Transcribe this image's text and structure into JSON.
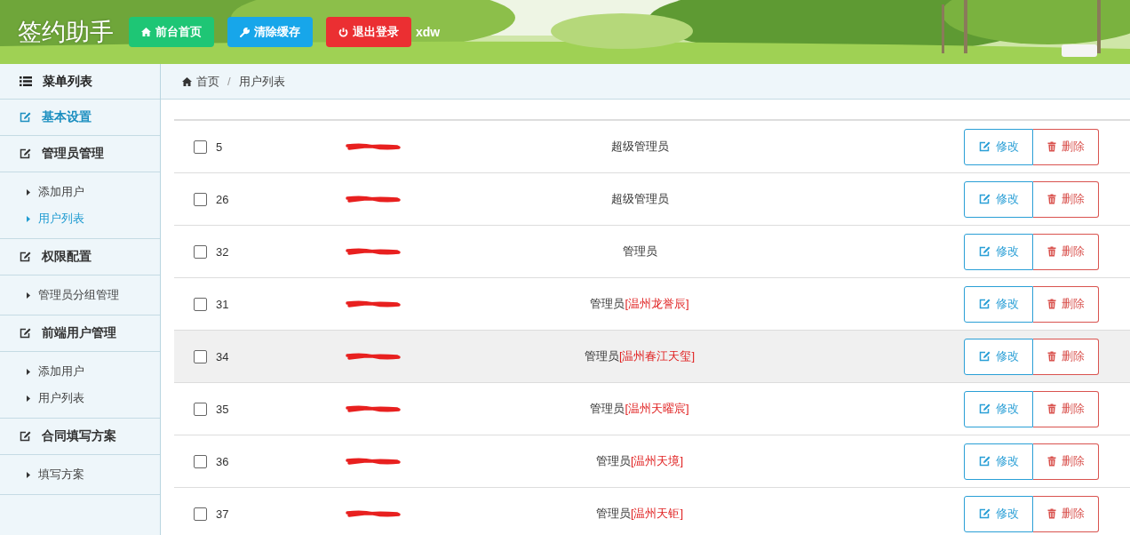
{
  "header": {
    "title": "签约助手",
    "buttons": [
      {
        "label": "前台首页",
        "kind": "home"
      },
      {
        "label": "清除缓存",
        "kind": "clear"
      },
      {
        "label": "退出登录",
        "kind": "logout"
      }
    ],
    "user": "xdw"
  },
  "sidebar": {
    "title": "菜单列表",
    "sections": [
      {
        "label": "基本设置",
        "selected": true
      },
      {
        "label": "管理员管理",
        "selected": false,
        "children": [
          {
            "label": "添加用户",
            "selected": false
          },
          {
            "label": "用户列表",
            "selected": true
          }
        ]
      },
      {
        "label": "权限配置",
        "selected": false,
        "children": [
          {
            "label": "管理员分组管理",
            "selected": false
          }
        ]
      },
      {
        "label": "前端用户管理",
        "selected": false,
        "children": [
          {
            "label": "添加用户",
            "selected": false
          },
          {
            "label": "用户列表",
            "selected": false
          }
        ]
      },
      {
        "label": "合同填写方案",
        "selected": false,
        "children": [
          {
            "label": "填写方案",
            "selected": false
          }
        ]
      }
    ]
  },
  "breadcrumb": {
    "separator": "/",
    "items": [
      {
        "label": "首页",
        "kind": "home"
      },
      {
        "label": "用户列表",
        "kind": "current"
      }
    ]
  },
  "table": {
    "rows": [
      {
        "checked": false,
        "hovered": false,
        "id": "5",
        "role": "超级管理员",
        "actions": [
          {
            "label": "修改",
            "kind": "edit"
          },
          {
            "label": "删除",
            "kind": "delete"
          }
        ]
      },
      {
        "checked": false,
        "hovered": false,
        "id": "26",
        "role": "超级管理员",
        "actions": [
          {
            "label": "修改",
            "kind": "edit"
          },
          {
            "label": "删除",
            "kind": "delete"
          }
        ]
      },
      {
        "checked": false,
        "hovered": false,
        "id": "32",
        "role": "管理员",
        "actions": [
          {
            "label": "修改",
            "kind": "edit"
          },
          {
            "label": "删除",
            "kind": "delete"
          }
        ]
      },
      {
        "checked": false,
        "hovered": false,
        "id": "31",
        "role": "管理员",
        "org": "[温州龙誉辰]",
        "actions": [
          {
            "label": "修改",
            "kind": "edit"
          },
          {
            "label": "删除",
            "kind": "delete"
          }
        ]
      },
      {
        "checked": false,
        "hovered": true,
        "id": "34",
        "role": "管理员",
        "org": "[温州春江天玺]",
        "actions": [
          {
            "label": "修改",
            "kind": "edit"
          },
          {
            "label": "删除",
            "kind": "delete"
          }
        ]
      },
      {
        "checked": false,
        "hovered": false,
        "id": "35",
        "role": "管理员",
        "org": "[温州天曜宸]",
        "actions": [
          {
            "label": "修改",
            "kind": "edit"
          },
          {
            "label": "删除",
            "kind": "delete"
          }
        ]
      },
      {
        "checked": false,
        "hovered": false,
        "id": "36",
        "role": "管理员",
        "org": "[温州天境]",
        "actions": [
          {
            "label": "修改",
            "kind": "edit"
          },
          {
            "label": "删除",
            "kind": "delete"
          }
        ]
      },
      {
        "checked": false,
        "hovered": false,
        "id": "37",
        "role": "管理员",
        "org": "[温州天钜]",
        "actions": [
          {
            "label": "修改",
            "kind": "edit"
          },
          {
            "label": "删除",
            "kind": "delete"
          }
        ]
      }
    ]
  }
}
